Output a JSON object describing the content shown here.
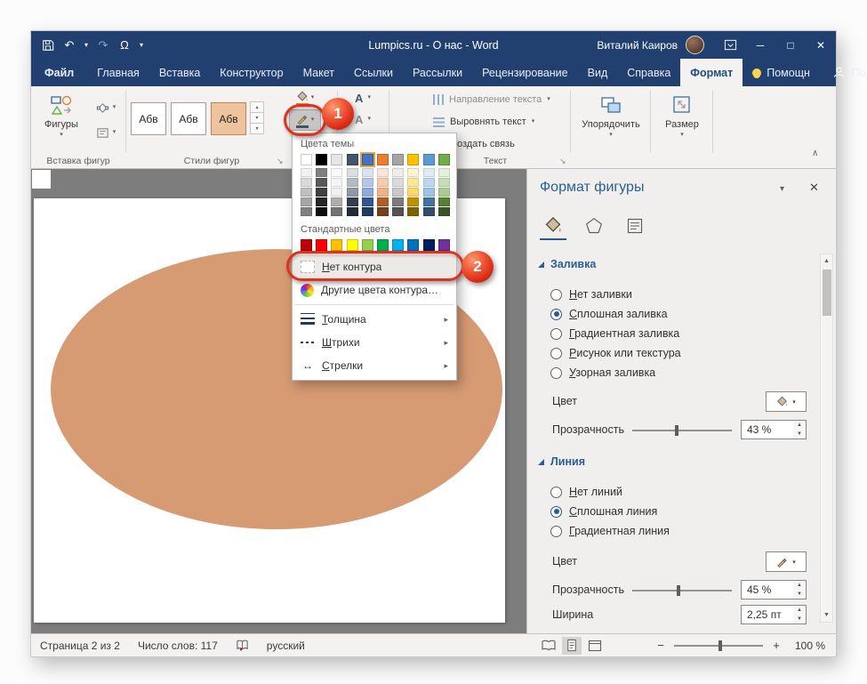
{
  "window": {
    "title": "Lumpics.ru - О нас - Word",
    "user": "Виталий Каиров"
  },
  "tabs": {
    "file": "Файл",
    "main": [
      "Главная",
      "Вставка",
      "Конструктор",
      "Макет",
      "Ссылки",
      "Рассылки",
      "Рецензирование",
      "Вид",
      "Справка"
    ],
    "active": "Формат",
    "assistant": "Помощн",
    "share": "Поделиться"
  },
  "ribbon": {
    "shapes_button": "Фигуры",
    "style_previews": [
      "Абв",
      "Абв",
      "Абв"
    ],
    "wordart_letters": [
      "А",
      "А",
      "А"
    ],
    "text_items": [
      "Направление текста",
      "Выровнять текст",
      "Создать связь"
    ],
    "arrange_button": "Упорядочить",
    "size_button": "Размер",
    "group_labels": {
      "insert_shapes": "Вставка фигур",
      "shape_styles": "Стили фигур",
      "text": "Текст"
    }
  },
  "outline_menu": {
    "theme_label": "Цвета темы",
    "standard_label": "Стандартные цвета",
    "theme_colors": [
      "#FFFFFF",
      "#000000",
      "#E7E6E6",
      "#44546A",
      "#4472C4",
      "#ED7D31",
      "#A5A5A5",
      "#FFC000",
      "#5B9BD5",
      "#70AD47"
    ],
    "selected_index": 4,
    "standard_colors": [
      "#C00000",
      "#FF0000",
      "#FFC000",
      "#FFFF00",
      "#92D050",
      "#00B050",
      "#00B0F0",
      "#0070C0",
      "#002060",
      "#7030A0"
    ],
    "items": [
      {
        "key": "no-outline",
        "label": "Нет контура",
        "icon": "no-outline-icon",
        "submenu": false,
        "highlighted": true
      },
      {
        "key": "more-outline-colors",
        "label": "Другие цвета контура…",
        "icon": "color-wheel-icon",
        "submenu": false,
        "highlighted": false
      },
      {
        "key": "weight",
        "label": "Толщина",
        "icon": "weight-icon",
        "submenu": true,
        "highlighted": false
      },
      {
        "key": "dashes",
        "label": "Штрихи",
        "icon": "dashes-icon",
        "submenu": true,
        "highlighted": false
      },
      {
        "key": "arrows",
        "label": "Стрелки",
        "icon": "arrows-icon",
        "submenu": true,
        "highlighted": false
      }
    ]
  },
  "format_panel": {
    "title": "Формат фигуры",
    "fill": {
      "title": "Заливка",
      "options": [
        "Нет заливки",
        "Сплошная заливка",
        "Градиентная заливка",
        "Рисунок или текстура",
        "Узорная заливка"
      ],
      "selected_index": 1,
      "color_label": "Цвет",
      "transparency_label": "Прозрачность",
      "transparency_value": "43 %"
    },
    "line": {
      "title": "Линия",
      "options": [
        "Нет линий",
        "Сплошная линия",
        "Градиентная линия"
      ],
      "selected_index": 1,
      "color_label": "Цвет",
      "transparency_label": "Прозрачность",
      "transparency_value": "45 %",
      "width_label": "Ширина",
      "width_value": "2,25 пт"
    }
  },
  "status_bar": {
    "page": "Страница 2 из 2",
    "words": "Число слов: 117",
    "language": "русский",
    "zoom": "100 %"
  },
  "annotations": {
    "step1": "1",
    "step2": "2"
  },
  "canvas": {
    "shape_fill": "#d69b73"
  },
  "colors": {
    "titlebar": "#21406f",
    "annotation_red": "#e0301e",
    "fill_bar": "#ed7d31",
    "outline_bar": "#44546a"
  }
}
